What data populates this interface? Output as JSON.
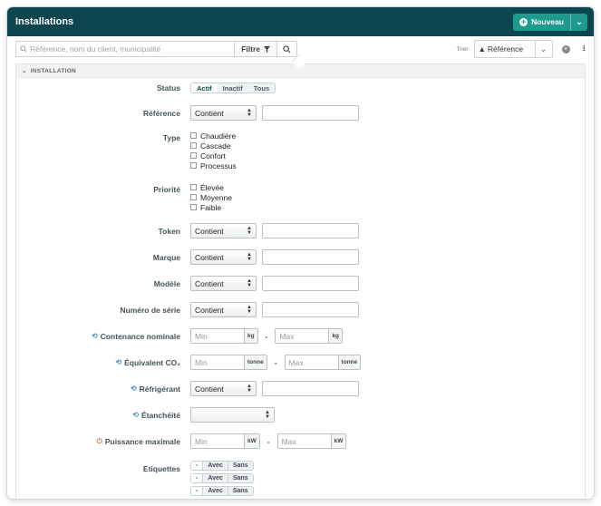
{
  "header": {
    "title": "Installations",
    "new_label": "Nouveau"
  },
  "toolbar": {
    "search_placeholder": "Référence, nom du client, municipalité",
    "filter_label": "Filtre",
    "sort_label": "Trier",
    "sort_value": "Référence"
  },
  "section": {
    "title": "INSTALLATION"
  },
  "form": {
    "status": {
      "label": "Status",
      "options": [
        "Actif",
        "Inactif",
        "Tous"
      ],
      "selected": "Actif"
    },
    "reference": {
      "label": "Référence",
      "op": "Contient"
    },
    "type": {
      "label": "Type",
      "options": [
        "Chaudière",
        "Cascade",
        "Confort",
        "Processus"
      ]
    },
    "priorite": {
      "label": "Priorité",
      "options": [
        "Élevée",
        "Moyenne",
        "Faible"
      ]
    },
    "token": {
      "label": "Token",
      "op": "Contient"
    },
    "marque": {
      "label": "Marque",
      "op": "Contient"
    },
    "modele": {
      "label": "Modèle",
      "op": "Contient"
    },
    "numero": {
      "label": "Numéro de série",
      "op": "Contient"
    },
    "contenance": {
      "label": "Contenance nominale",
      "min": "Min",
      "max": "Max",
      "unit": "kg"
    },
    "equivalent": {
      "label": "Équivalent CO₂",
      "min": "Min",
      "max": "Max",
      "unit": "tonne"
    },
    "refrigerant": {
      "label": "Réfrigérant",
      "op": "Contient"
    },
    "etancheite": {
      "label": "Étanchéité",
      "op": ""
    },
    "puissance": {
      "label": "Puissance maximale",
      "min": "Min",
      "max": "Max",
      "unit": "kW"
    },
    "etiquettes": {
      "label": "Etiquettes",
      "options": [
        "-",
        "Avec",
        "Sans"
      ]
    }
  }
}
